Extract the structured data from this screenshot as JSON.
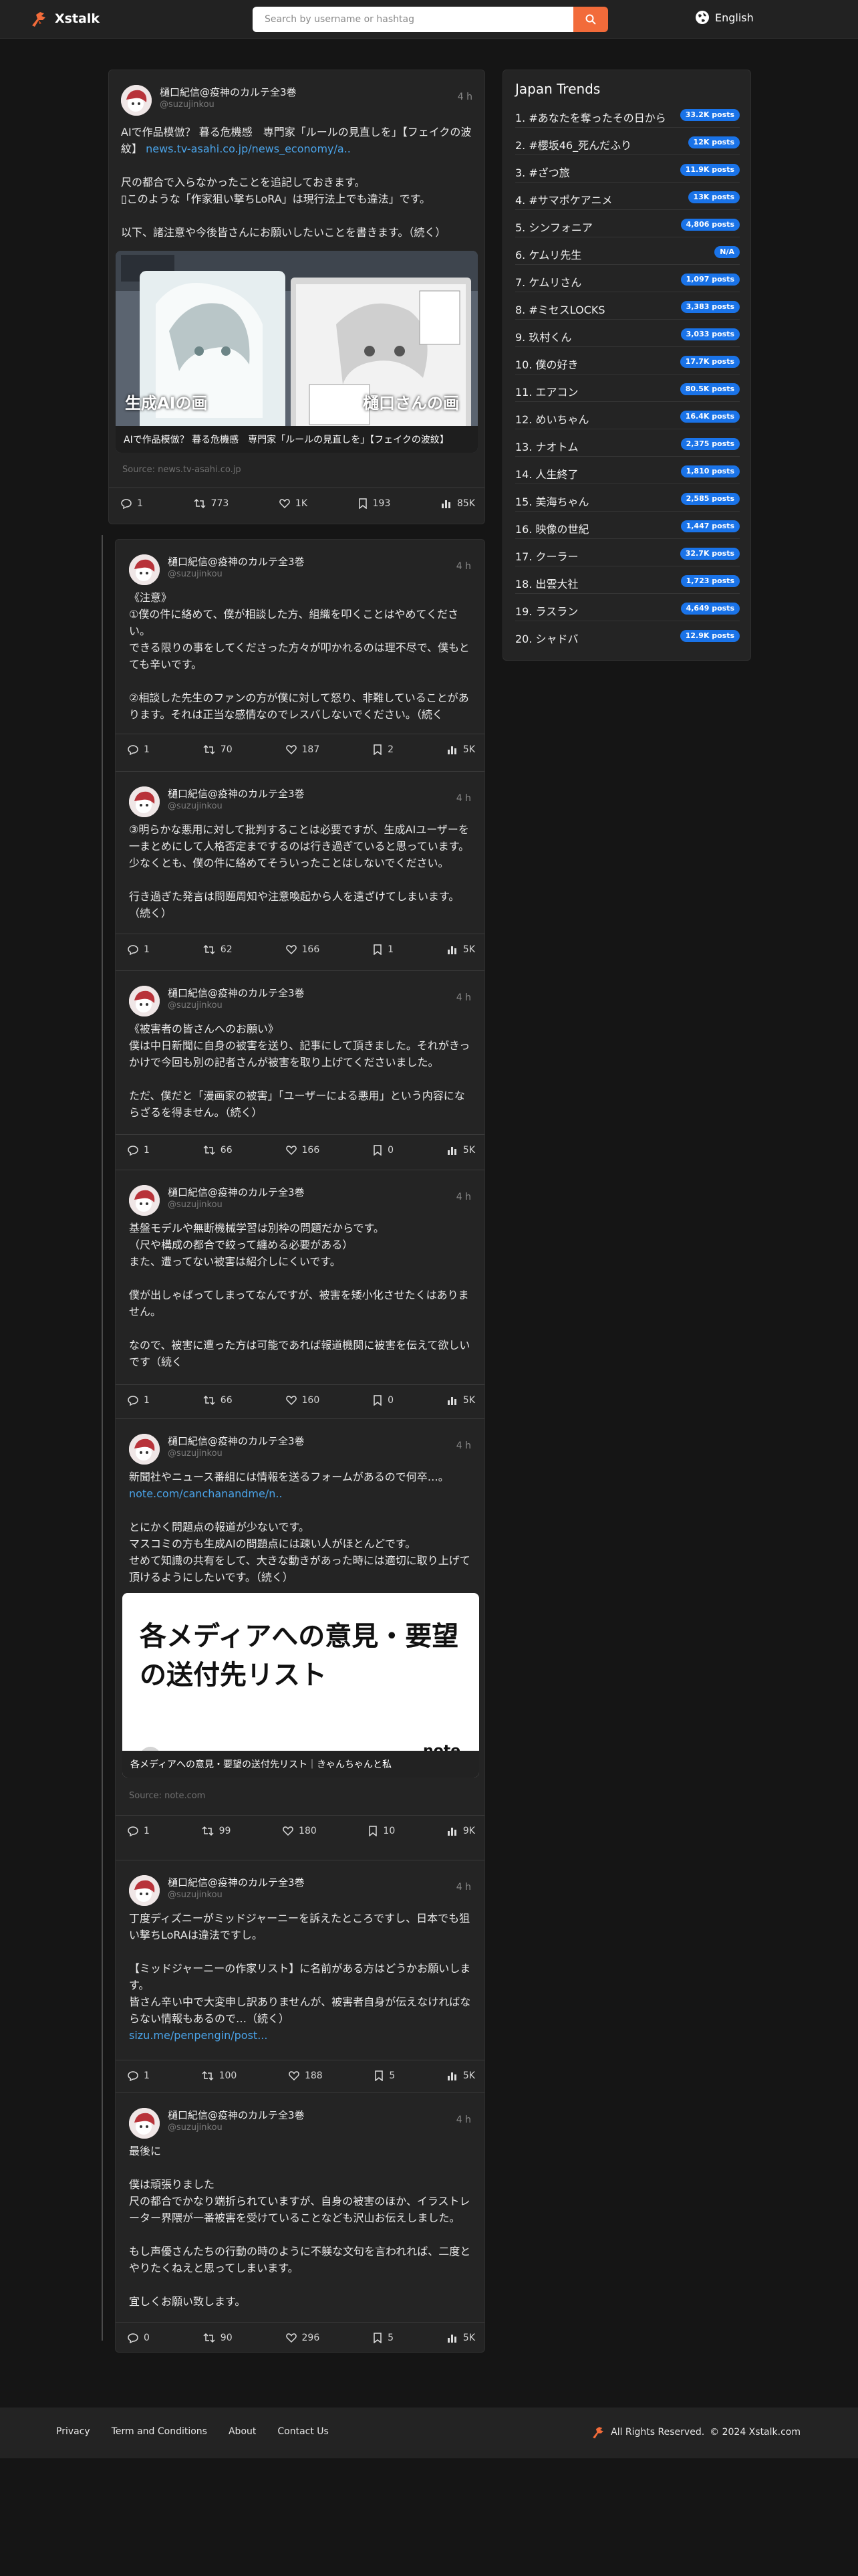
{
  "brand": {
    "name": "Xstalk",
    "accent": "#f26b3a"
  },
  "search": {
    "placeholder": "Search by username or hashtag"
  },
  "language": {
    "label": "English"
  },
  "main_post": {
    "author": "樋口紀信@疫神のカルテ全3巻",
    "handle": "@suzujinkou",
    "time": "4 h",
    "text_before_link": "AIで作品模倣？ 暮る危機感　専門家「ルールの見直しを」【フェイクの波紋】 ",
    "link": "news.tv-asahi.co.jp/news_economy/a..",
    "text_after_link": "\n\n尺の都合で入らなかったことを追記しておきます。\n▯このような「作家狙い撃ちLoRA」は現行法上でも違法」です。\n\n以下、諸注意や今後皆さんにお願いしたいことを書きます。（続く）",
    "media": {
      "caption": "AIで作品模倣？ 暮る危機感　専門家「ルールの見直しを」【フェイクの波紋】",
      "label_left": "生成AIの画",
      "label_right": "樋口さんの画"
    },
    "source": "Source: news.tv-asahi.co.jp",
    "stats": {
      "replies": "1",
      "reposts": "773",
      "likes": "1K",
      "bookmarks": "193",
      "views": "85K"
    }
  },
  "thread": [
    {
      "author": "樋口紀信@疫神のカルテ全3巻",
      "handle": "@suzujinkou",
      "time": "4 h",
      "text": "《注意》\n①僕の件に絡めて、僕が相談した方、組織を叩くことはやめてください。\nできる限りの事をしてくださった方々が叩かれるのは理不尽で、僕もとても辛いです。\n\n②相談した先生のファンの方が僕に対して怒り、非難していることがあります。それは正当な感情なのでレスバしないでください。（続く",
      "stats": {
        "replies": "1",
        "reposts": "70",
        "likes": "187",
        "bookmarks": "2",
        "views": "5K"
      }
    },
    {
      "author": "樋口紀信@疫神のカルテ全3巻",
      "handle": "@suzujinkou",
      "time": "4 h",
      "text": "③明らかな悪用に対して批判することは必要ですが、生成AIユーザーを一まとめにして人格否定までするのは行き過ぎていると思っています。\n少なくとも、僕の件に絡めてそういったことはしないでください。\n\n行き過ぎた発言は問題周知や注意喚起から人を遠ざけてしまいます。（続く）",
      "stats": {
        "replies": "1",
        "reposts": "62",
        "likes": "166",
        "bookmarks": "1",
        "views": "5K"
      }
    },
    {
      "author": "樋口紀信@疫神のカルテ全3巻",
      "handle": "@suzujinkou",
      "time": "4 h",
      "text": "《被害者の皆さんへのお願い》\n僕は中日新聞に自身の被害を送り、記事にして頂きました。それがきっかけで今回も別の記者さんが被害を取り上げてくださいました。\n\nただ、僕だと「漫画家の被害」「ユーザーによる悪用」という内容にならざるを得ません。（続く）",
      "stats": {
        "replies": "1",
        "reposts": "66",
        "likes": "166",
        "bookmarks": "0",
        "views": "5K"
      }
    },
    {
      "author": "樋口紀信@疫神のカルテ全3巻",
      "handle": "@suzujinkou",
      "time": "4 h",
      "text": "基盤モデルや無断機械学習は別枠の問題だからです。\n（尺や構成の都合で絞って纏める必要がある）\nまた、遭ってない被害は紹介しにくいです。\n\n僕が出しゃばってしまってなんですが、被害を矮小化させたくはありません。\n\nなので、被害に遭った方は可能であれば報道機関に被害を伝えて欲しいです（続く",
      "stats": {
        "replies": "1",
        "reposts": "66",
        "likes": "160",
        "bookmarks": "0",
        "views": "5K"
      }
    },
    {
      "author": "樋口紀信@疫神のカルテ全3巻",
      "handle": "@suzujinkou",
      "time": "4 h",
      "text_before_link": "新聞社やニュース番組には情報を送るフォームがあるので何卒…。\n",
      "link": "note.com/canchanandme/n..",
      "text_after_link": "\n\nとにかく問題点の報道が少ないです。\nマスコミの方も生成AIの問題点には疎い人がほとんどです。\nせめて知識の共有をして、大きな動きがあった時には適切に取り上げて頂けるようにしたいです。（続く）",
      "media": {
        "headline": "各メディアへの意見・要望の送付先リスト",
        "caption": "各メディアへの意見・要望の送付先リスト｜きゃんちゃんと私",
        "brand": "note"
      },
      "source": "Source: note.com",
      "stats": {
        "replies": "1",
        "reposts": "99",
        "likes": "180",
        "bookmarks": "10",
        "views": "9K"
      }
    },
    {
      "author": "樋口紀信@疫神のカルテ全3巻",
      "handle": "@suzujinkou",
      "time": "4 h",
      "text_before_link": "丁度ディズニーがミッドジャーニーを訴えたところですし、日本でも狙い撃ちLoRAは違法ですし。\n\n【ミッドジャーニーの作家リスト】に名前がある方はどうかお願いします。\n皆さん辛い中で大変申し訳ありませんが、被害者自身が伝えなければならない情報もあるので…（続く）\n",
      "link": "sizu.me/penpengin/post...",
      "text_after_link": "",
      "stats": {
        "replies": "1",
        "reposts": "100",
        "likes": "188",
        "bookmarks": "5",
        "views": "5K"
      }
    },
    {
      "author": "樋口紀信@疫神のカルテ全3巻",
      "handle": "@suzujinkou",
      "time": "4 h",
      "text": "最後に\n\n僕は頑張りました\n尺の都合でかなり端折られていますが、自身の被害のほか、イラストレーター界隈が一番被害を受けていることなども沢山お伝えしました。\n\nもし声優さんたちの行動の時のように不躾な文句を言われれば、二度とやりたくねえと思ってしまいます。\n\n宜しくお願い致します。",
      "stats": {
        "replies": "0",
        "reposts": "90",
        "likes": "296",
        "bookmarks": "5",
        "views": "5K"
      }
    }
  ],
  "trends": {
    "title": "Japan Trends",
    "items": [
      {
        "name": "1. #あなたを奪ったその日から",
        "count": "33.2K posts"
      },
      {
        "name": "2. #櫻坂46_死んだふり",
        "count": "12K posts"
      },
      {
        "name": "3. #ざつ旅",
        "count": "11.9K posts"
      },
      {
        "name": "4. #サマポケアニメ",
        "count": "13K posts"
      },
      {
        "name": "5. シンフォニア",
        "count": "4,806 posts"
      },
      {
        "name": "6. ケムリ先生",
        "count": "N/A"
      },
      {
        "name": "7. ケムリさん",
        "count": "1,097 posts"
      },
      {
        "name": "8. #ミセスLOCKS",
        "count": "3,383 posts"
      },
      {
        "name": "9. 玖村くん",
        "count": "3,033 posts"
      },
      {
        "name": "10. 僕の好き",
        "count": "17.7K posts"
      },
      {
        "name": "11. エアコン",
        "count": "80.5K posts"
      },
      {
        "name": "12. めいちゃん",
        "count": "16.4K posts"
      },
      {
        "name": "13. ナオトム",
        "count": "2,375 posts"
      },
      {
        "name": "14. 人生終了",
        "count": "1,810 posts"
      },
      {
        "name": "15. 美海ちゃん",
        "count": "2,585 posts"
      },
      {
        "name": "16. 映像の世紀",
        "count": "1,447 posts"
      },
      {
        "name": "17. クーラー",
        "count": "32.7K posts"
      },
      {
        "name": "18. 出雲大社",
        "count": "1,723 posts"
      },
      {
        "name": "19. ラスラン",
        "count": "4,649 posts"
      },
      {
        "name": "20. シャドバ",
        "count": "12.9K posts"
      }
    ]
  },
  "footer": {
    "links": [
      "Privacy",
      "Term and Conditions",
      "About",
      "Contact Us"
    ],
    "rights": "All Rights Reserved.",
    "copyright": "© 2024 Xstalk.com"
  }
}
